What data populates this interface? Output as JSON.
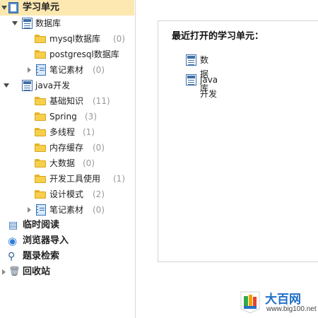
{
  "sidebar": {
    "root": {
      "label": "学习单元"
    },
    "groups": [
      {
        "label": "数据库",
        "folders": [
          {
            "label": "mysql数据库",
            "count": "(0)"
          },
          {
            "label": "postgresql数据库",
            "count": ""
          }
        ],
        "notes": {
          "label": "笔记素材",
          "count": "(0)"
        }
      },
      {
        "label": "java开发",
        "folders": [
          {
            "label": "基础知识",
            "count": "(11)"
          },
          {
            "label": "Spring",
            "count": "(3)"
          },
          {
            "label": "多线程",
            "count": "(1)"
          },
          {
            "label": "内存缓存",
            "count": "(0)"
          },
          {
            "label": "大数据",
            "count": "(0)"
          },
          {
            "label": "开发工具使用",
            "count": "(1)"
          },
          {
            "label": "设计模式",
            "count": "(2)"
          }
        ],
        "notes": {
          "label": "笔记素材",
          "count": "(0)"
        }
      }
    ],
    "sections": [
      {
        "label": "临时阅读",
        "icon": "clock-book-icon"
      },
      {
        "label": "浏览器导入",
        "icon": "browser-import-icon"
      },
      {
        "label": "题录检索",
        "icon": "magnifier-icon"
      },
      {
        "label": "回收站",
        "icon": "trash-icon"
      }
    ]
  },
  "main": {
    "title": "最近打开的学习单元：",
    "recent": [
      {
        "label": "数据库"
      },
      {
        "label": "java开发"
      }
    ]
  },
  "watermark": {
    "name": "大百网",
    "url": "www.big100.net"
  },
  "colors": {
    "selected_bg": "#fce8b0",
    "folder": "#f7cf4a",
    "db_blue": "#3e6ea8",
    "count_gray": "#999999"
  }
}
